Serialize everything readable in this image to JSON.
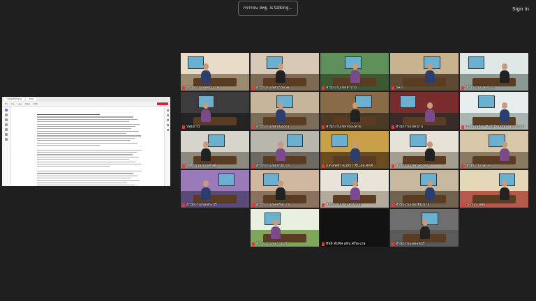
{
  "top_bar": {
    "talking_indicator": "กรรรจน สพฐ. is talking...",
    "sign_in": "Sign in"
  },
  "shared_screen": {
    "tabs": [
      "ระบบบริหารงาน",
      "Edit"
    ],
    "menu": [
      "Ho",
      "Ins",
      "Lay",
      "View",
      "Edit"
    ]
  },
  "participants": [
    {
      "name": "สำนักงานเขตคุณภาพ",
      "scene": "classroom"
    },
    {
      "name": "สำนักงานเขตบรรดาศ",
      "scene": "office-woman"
    },
    {
      "name": "สำนักงานเขตลำปาง",
      "scene": "green-room"
    },
    {
      "name": "บคบ",
      "scene": "conference"
    },
    {
      "name": "สำนักงานเขตพะเยา",
      "scene": "meeting-room"
    },
    {
      "name": "ปทุมธานี",
      "scene": "dark-office"
    },
    {
      "name": "สำนักงานเขตหนองกา",
      "scene": "curtain"
    },
    {
      "name": "สำนักงานเขตหนองคาย",
      "scene": "wood-room"
    },
    {
      "name": "สำนักงานเขตน่าน",
      "scene": "red-room"
    },
    {
      "name": "นายกฤษติยา ทิพย์เนียม ผอ.สพป.สงขลา",
      "scene": "white-room"
    },
    {
      "name": "สพฐ. ยาลากอลดิษฐ์",
      "scene": "flag-office"
    },
    {
      "name": "สำนักงานเขตชายนาท",
      "scene": "gray-office"
    },
    {
      "name": "ผ.ต.ศพฬร ศุนย์ปราจีน ผอ.ศพฬ",
      "scene": "gold-room"
    },
    {
      "name": "สำนักงานเขตนครปฐม",
      "scene": "office-bright"
    },
    {
      "name": "สำนักงานเขตเลย",
      "scene": "beige-room"
    },
    {
      "name": "สำนักงานเขตสระบุรี",
      "scene": "purple-banner"
    },
    {
      "name": "สำนักงานเขตศรีสะเกษ",
      "scene": "woman-close"
    },
    {
      "name": "สำนักงานเขตนครนายก",
      "scene": "masked"
    },
    {
      "name": "สำนักงานเขตเชียงราย",
      "scene": "mixed"
    },
    {
      "name": "กรรรจน สพฐ.",
      "scene": "speaker"
    },
    {
      "name": "สำนักงานเขตราชบุรี",
      "scene": "green-poster"
    },
    {
      "name": "ทิพย์ ทับทิพ สพป.ศรีสะเกษ",
      "scene": "black"
    },
    {
      "name": "สำนักงานเขตลพบุรี",
      "scene": "gray-blur"
    }
  ],
  "colors": {
    "background": "#1f1f1f",
    "mic_muted": "#e53935",
    "share_button": "#dd2233"
  }
}
